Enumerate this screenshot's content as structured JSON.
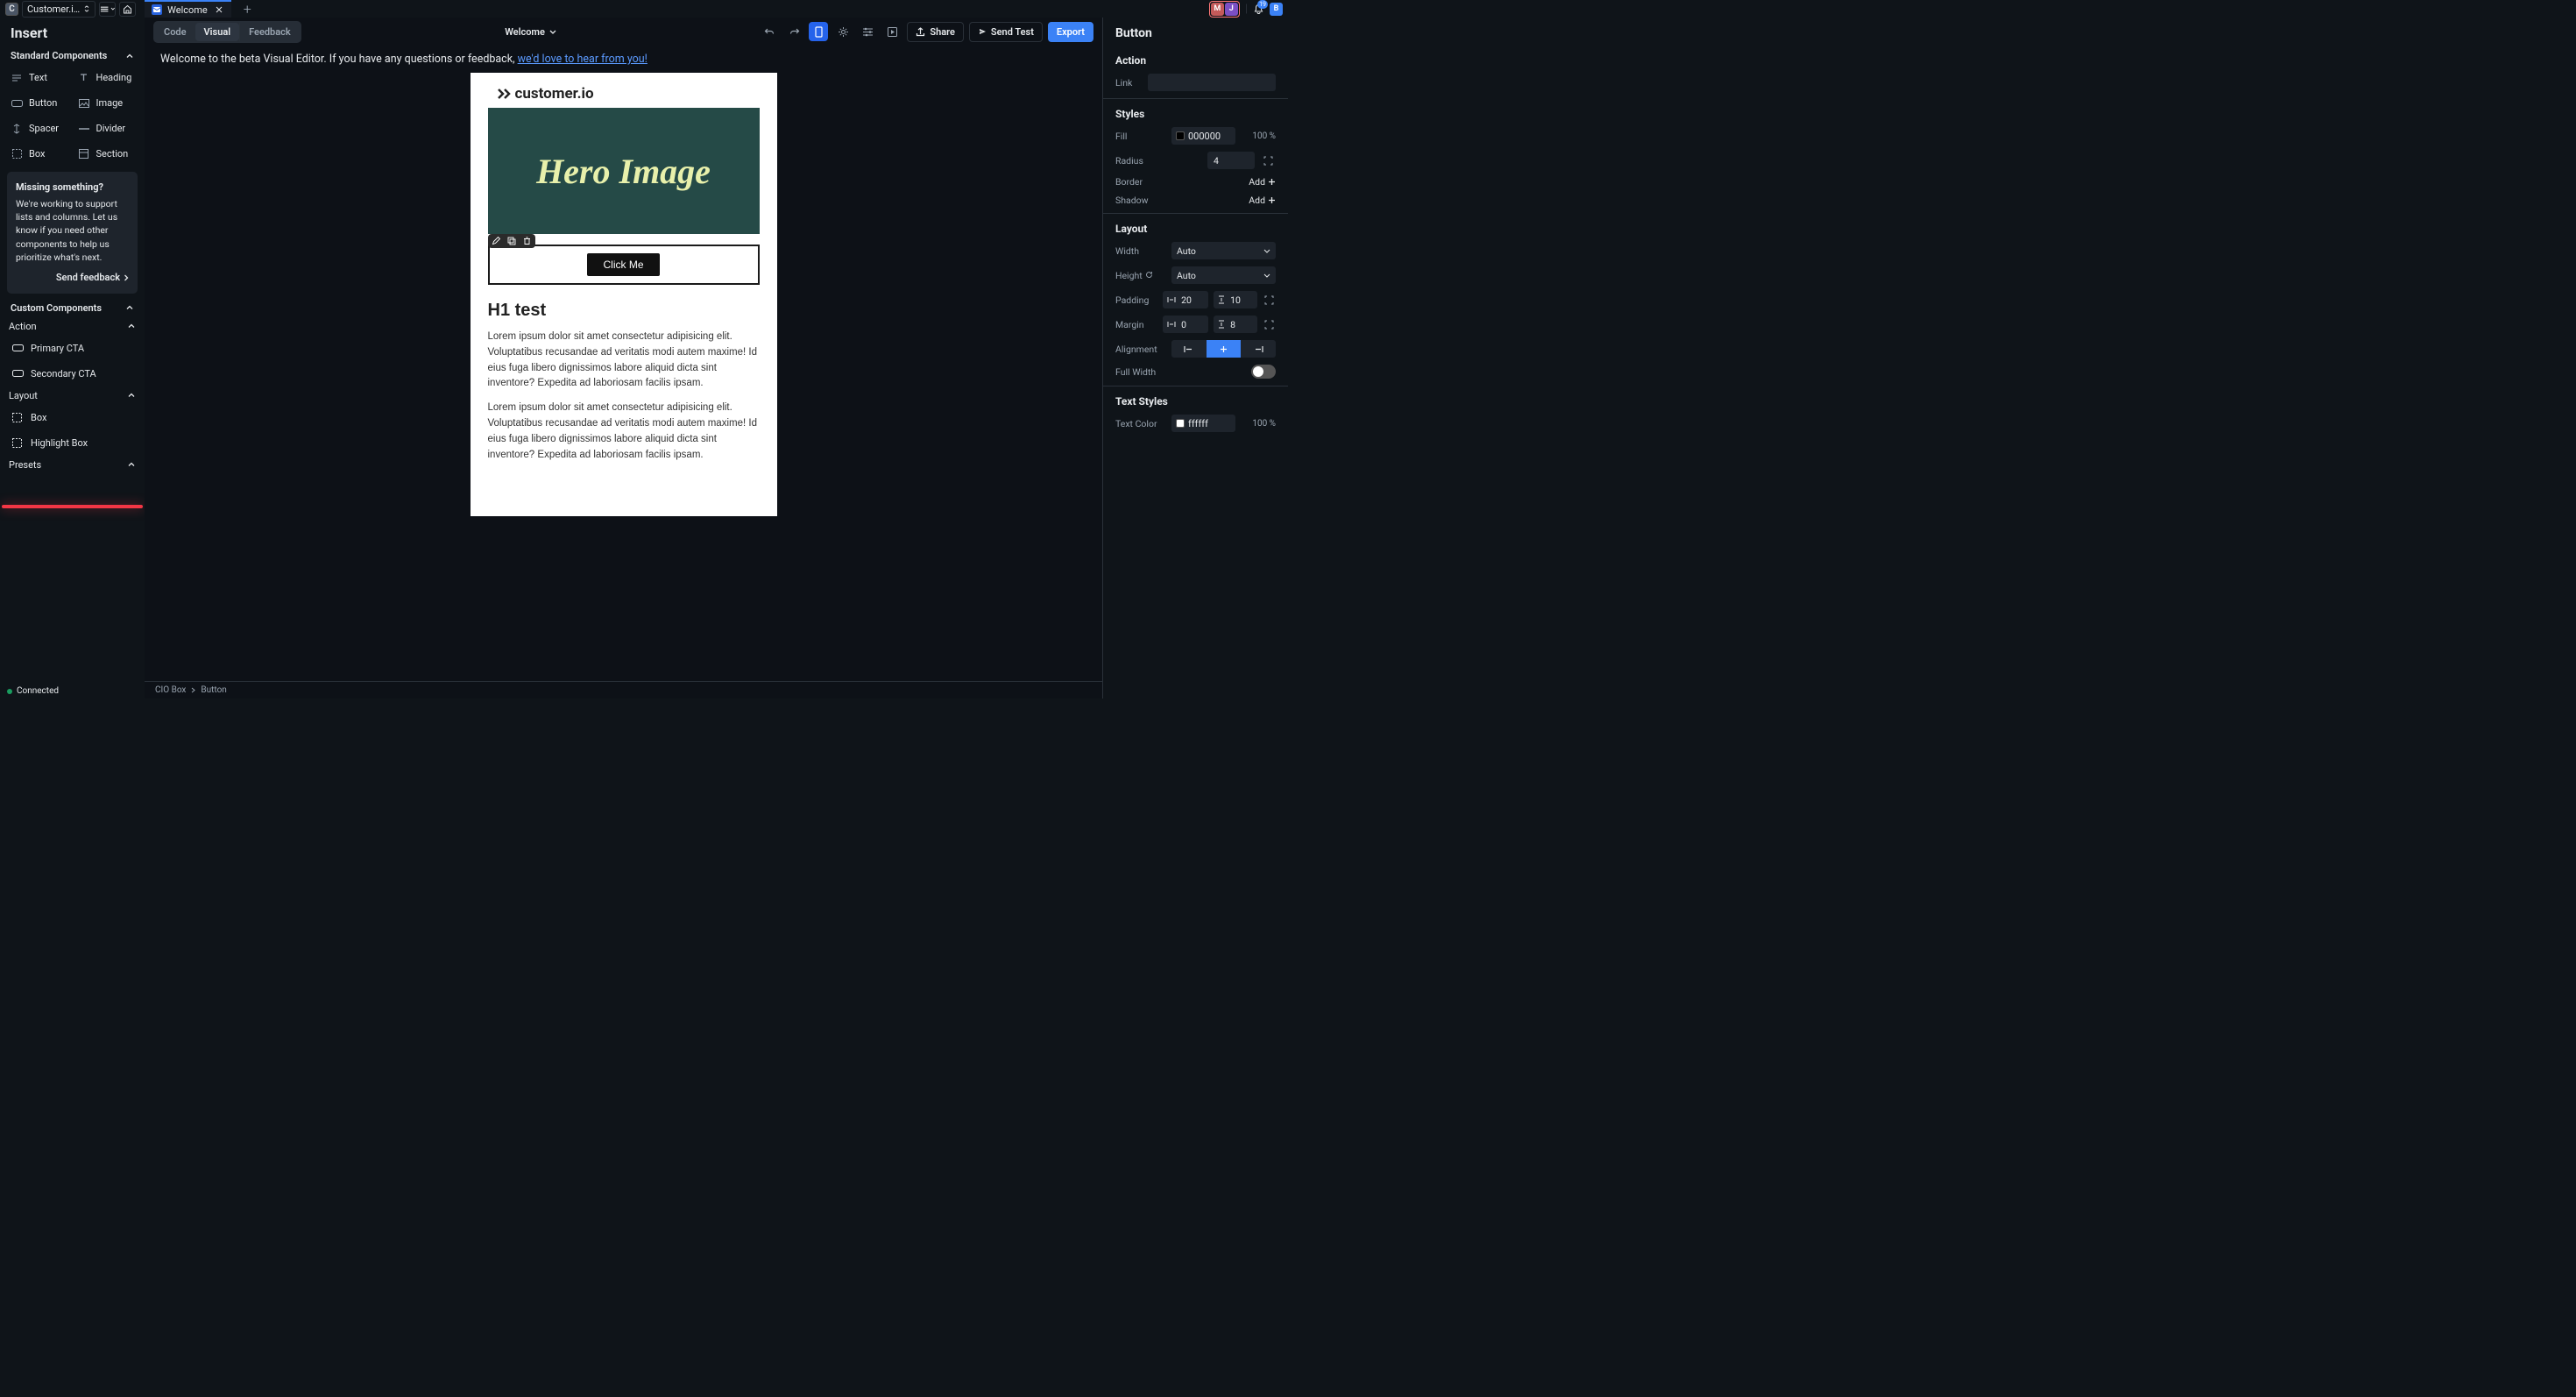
{
  "topbar": {
    "project_badge": "C",
    "project_name": "Customer.i…",
    "tab_name": "Welcome",
    "avatars": [
      "M",
      "J"
    ],
    "avatar_right": "B",
    "notif_count": "19"
  },
  "left": {
    "title": "Insert",
    "standard_header": "Standard Components",
    "components": [
      {
        "label": "Text"
      },
      {
        "label": "Heading"
      },
      {
        "label": "Button"
      },
      {
        "label": "Image"
      },
      {
        "label": "Spacer"
      },
      {
        "label": "Divider"
      },
      {
        "label": "Box"
      },
      {
        "label": "Section"
      }
    ],
    "missing": {
      "title": "Missing something?",
      "body": "We're working to support lists and columns. Let us know if you need other components to help us prioritize what's next.",
      "cta": "Send feedback"
    },
    "custom_header": "Custom Components",
    "action_header": "Action",
    "action_items": [
      "Primary CTA",
      "Secondary CTA"
    ],
    "layout_header": "Layout",
    "layout_items": [
      "Box",
      "Highlight Box"
    ],
    "presets_header": "Presets",
    "status": "Connected"
  },
  "toolbar": {
    "code": "Code",
    "visual": "Visual",
    "feedback": "Feedback",
    "doc_title": "Welcome",
    "share": "Share",
    "send_test": "Send Test",
    "export": "Export"
  },
  "banner": {
    "text": "Welcome to the beta Visual Editor. If you have any questions or feedback, ",
    "link": "we'd love to hear from you!"
  },
  "email": {
    "logo_text": "customer.io",
    "hero_text": "Hero Image",
    "button_text": "Click Me",
    "h1": "H1 test",
    "para": "Lorem ipsum dolor sit amet consectetur adipisicing elit. Voluptatibus recusandae ad veritatis modi autem maxime! Id eius fuga libero dignissimos labore aliquid dicta sint inventore? Expedita ad laboriosam facilis ipsam."
  },
  "breadcrumb": {
    "a": "CIO Box",
    "b": "Button"
  },
  "right": {
    "title": "Button",
    "action_hdr": "Action",
    "link_label": "Link",
    "link_value": "",
    "styles_hdr": "Styles",
    "fill_label": "Fill",
    "fill_value": "000000",
    "fill_pct": "100 %",
    "radius_label": "Radius",
    "radius_value": "4",
    "border_label": "Border",
    "shadow_label": "Shadow",
    "add_label": "Add",
    "layout_hdr": "Layout",
    "width_label": "Width",
    "width_value": "Auto",
    "height_label": "Height",
    "height_value": "Auto",
    "padding_label": "Padding",
    "padding_h": "20",
    "padding_v": "10",
    "margin_label": "Margin",
    "margin_h": "0",
    "margin_v": "8",
    "alignment_label": "Alignment",
    "fullwidth_label": "Full Width",
    "textstyles_hdr": "Text Styles",
    "textcolor_label": "Text Color",
    "textcolor_value": "ffffff",
    "textcolor_pct": "100 %"
  }
}
